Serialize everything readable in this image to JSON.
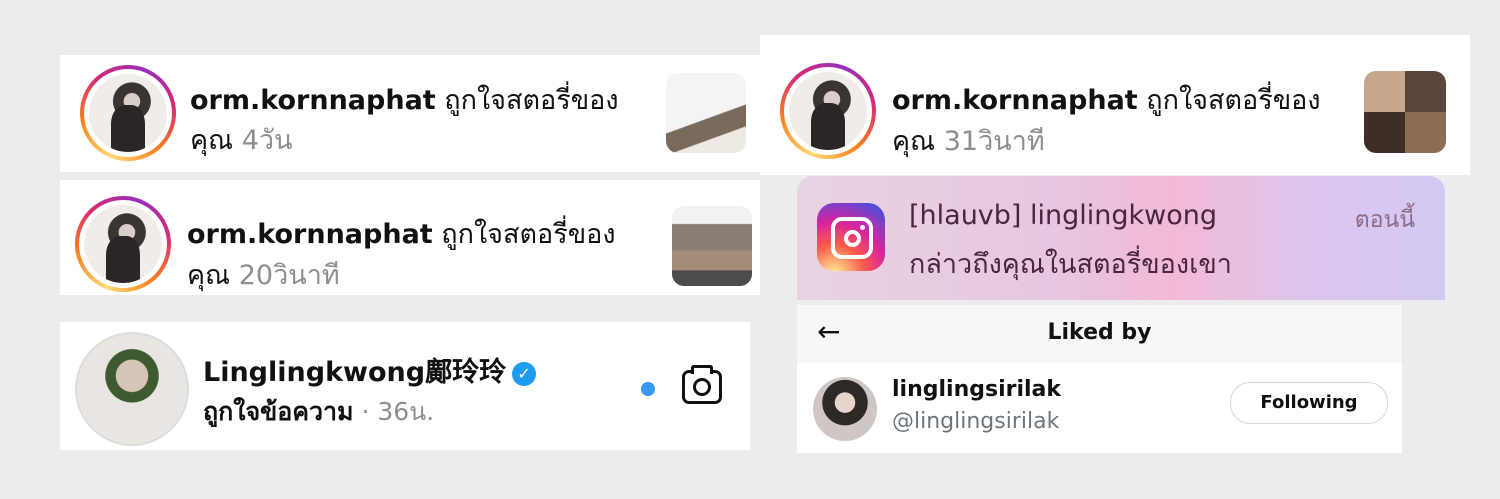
{
  "notifications": [
    {
      "username": "orm.kornnaphat",
      "action": "ถูกใจสตอรี่ของ",
      "action2": "คุณ",
      "time": "4วัน"
    },
    {
      "username": "orm.kornnaphat",
      "action": "ถูกใจสตอรี่ของ",
      "action2": "คุณ",
      "time": "20วินาที"
    },
    {
      "username": "orm.kornnaphat",
      "action": "ถูกใจสตอรี่ของ",
      "action2": "คุณ",
      "time": "31วินาที"
    }
  ],
  "message": {
    "name": "Linglingkwong鄺玲玲",
    "subtitle": "ถูกใจข้อความ",
    "dot": "·",
    "time": "36น."
  },
  "banner": {
    "title": "[hlauvb] linglingkwong",
    "body": "กล่าวถึงคุณในสตอรี่ของเขา",
    "time": "ตอนนี้"
  },
  "liked_by": {
    "title": "Liked by",
    "user": {
      "name": "linglingsirilak",
      "handle": "@linglingsirilak",
      "button": "Following"
    }
  },
  "colors": {
    "verified": "#1d9bf0",
    "unread_dot": "#3897f0",
    "muted": "#8e8e8e"
  }
}
